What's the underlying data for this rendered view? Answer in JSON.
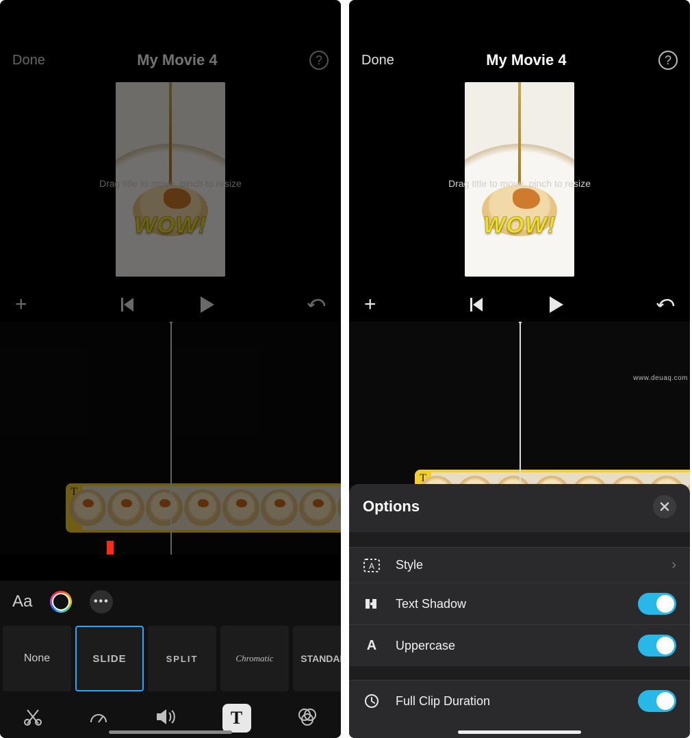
{
  "left": {
    "header": {
      "done": "Done",
      "title": "My Movie 4"
    },
    "preview": {
      "hint": "Drag title to move, pinch to resize",
      "overlay_text": "WOW!"
    },
    "clip": {
      "badge": "T"
    },
    "title_toolbar": {
      "font_label": "Aa",
      "more_label": "•••",
      "styles": {
        "none": "None",
        "slide": "SLIDE",
        "split": "SPLIT",
        "chromatic": "Chromatic",
        "standard": "STANDARD"
      },
      "active_tab_glyph": "T"
    }
  },
  "right": {
    "header": {
      "done": "Done",
      "title": "My Movie 4"
    },
    "preview": {
      "hint": "Drag title to move, pinch to resize",
      "overlay_text": "WOW!"
    },
    "clip": {
      "badge": "T"
    },
    "sheet": {
      "title": "Options",
      "rows": {
        "style": "Style",
        "text_shadow": "Text Shadow",
        "uppercase": "Uppercase",
        "full_clip": "Full Clip Duration"
      },
      "toggles": {
        "text_shadow": true,
        "uppercase": true,
        "full_clip": true
      }
    }
  },
  "watermark": "www.deuaq.com"
}
